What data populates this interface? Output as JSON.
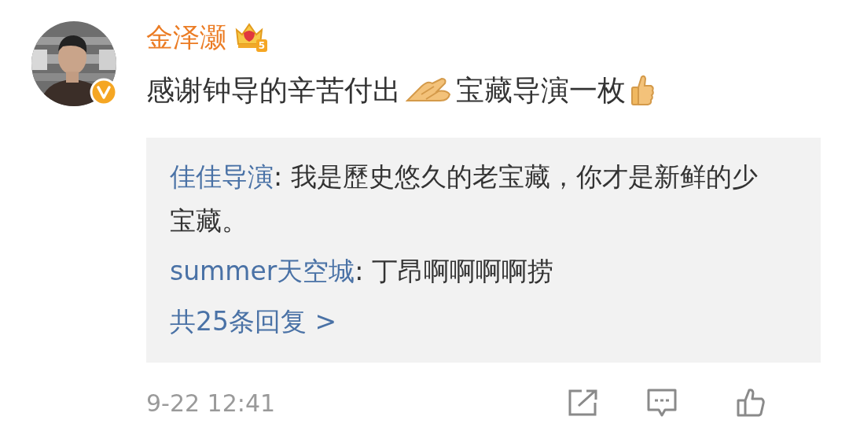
{
  "comment": {
    "author": "金泽灏",
    "verified": true,
    "vip_level": "5",
    "content": [
      {
        "kind": "text",
        "text": "感谢钟导的辛苦付出"
      },
      {
        "kind": "hands"
      },
      {
        "kind": "text",
        "text": "宝藏导演一枚"
      },
      {
        "kind": "thumbsup"
      }
    ],
    "replies": [
      {
        "user": "佳佳导演",
        "text": ": 我是歷史悠久的老宝藏，你才是新鲜的少宝藏。"
      },
      {
        "user": "summer天空城",
        "text": ": 丁昂啊啊啊啊捞"
      }
    ],
    "more_replies": "共25条回复 >",
    "time": "9-22 12:41"
  }
}
